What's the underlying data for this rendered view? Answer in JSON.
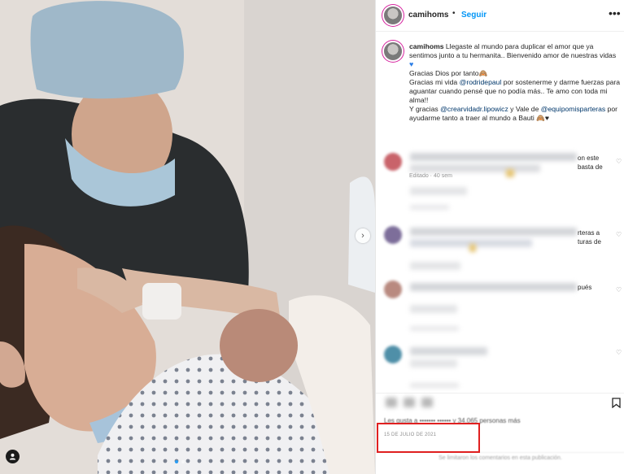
{
  "header": {
    "username": "camihoms",
    "separator": "•",
    "follow_label": "Seguir",
    "more_icon": "more-horizontal-icon"
  },
  "caption": {
    "username": "camihoms",
    "line1": "Llegaste al mundo para duplicar el amor que ya sentimos junto a tu hermanita.. Bienvenido amor de nuestras vidas",
    "line2": "Gracias Dios por tanto🙈",
    "line3_a": "Gracias mi vida ",
    "line3_mention": "@rodridepaul",
    "line3_b": " por sostenerme y darme fuerzas para aguantar cuando pensé que no podía más.. Te amo con toda mi alma!!",
    "line4_a": "Y gracias ",
    "line4_mention1": "@crearvidadr.lipowicz",
    "line4_b": " y Vale de ",
    "line4_mention2": "@equipomisparteras",
    "line4_c": " por ayudarme tanto a traer al mundo a Bauti 🙈♥",
    "edited": "Editado · 40 sem"
  },
  "comments": [
    {
      "tail": "on este\nbasta de"
    },
    {
      "tail": "rteras a\nturas de"
    },
    {
      "tail": "pués"
    },
    {
      "tail": ""
    }
  ],
  "likes_text": "Les gusta a ••••••• •••••• y 34.065 personas más",
  "date": "15 DE JULIO DE 2021",
  "comments_off": "Se limitaron los comentarios en esta publicación.",
  "colors": {
    "follow": "#0095f6",
    "mention": "#00376b",
    "highlight": "#e02020"
  }
}
